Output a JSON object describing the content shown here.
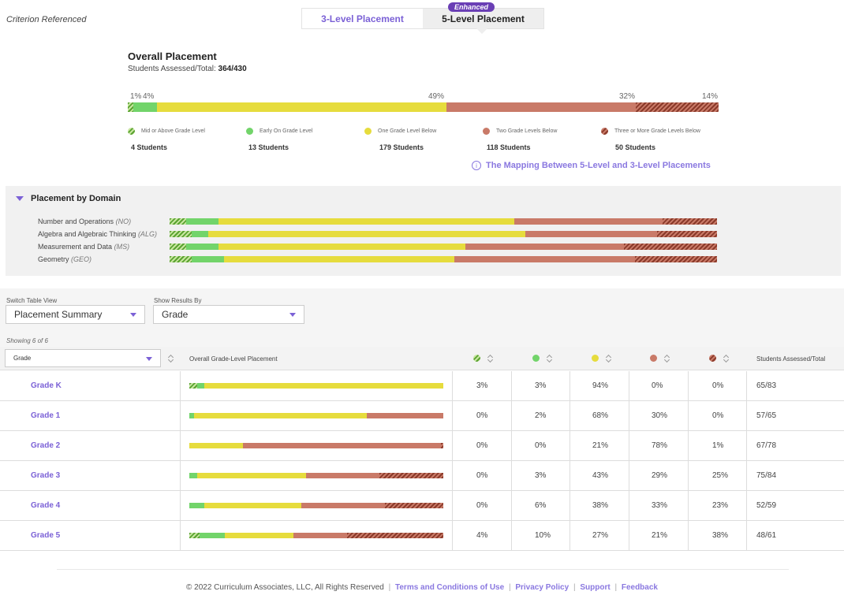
{
  "header": {
    "context_label": "Criterion Referenced",
    "tabs": [
      {
        "label": "3-Level Placement",
        "selected": false
      },
      {
        "label": "5-Level Placement",
        "selected": true
      }
    ],
    "badge": "Enhanced"
  },
  "overall": {
    "title": "Overall Placement",
    "assessed_label": "Students Assessed/Total:",
    "assessed_value": "364/430",
    "percent_labels": [
      "1%",
      "4%",
      "49%",
      "32%",
      "14%"
    ],
    "bar_segments": [
      1,
      4,
      49,
      32,
      14
    ]
  },
  "legend": [
    {
      "label": "Mid or Above Grade Level",
      "count": "4 Students",
      "color": "#5aa331"
    },
    {
      "label": "Early On Grade Level",
      "count": "13 Students",
      "color": "#72d46a"
    },
    {
      "label": "One Grade Level Below",
      "count": "179 Students",
      "color": "#e6dc3d"
    },
    {
      "label": "Two Grade Levels Below",
      "count": "118 Students",
      "color": "#c97a68"
    },
    {
      "label": "Three or More Grade Levels Below",
      "count": "50 Students",
      "color": "#8a3a2a"
    }
  ],
  "mapping_link": "The Mapping Between 5-Level and 3-Level Placements",
  "domain_panel": {
    "title": "Placement by Domain",
    "domains": [
      {
        "name": "Number and Operations",
        "abbr": "(NO)",
        "segments": [
          3,
          6,
          54,
          27,
          10
        ]
      },
      {
        "name": "Algebra and Algebraic Thinking",
        "abbr": "(ALG)",
        "segments": [
          4,
          3,
          58,
          24,
          11
        ]
      },
      {
        "name": "Measurement and Data",
        "abbr": "(MS)",
        "segments": [
          3,
          6,
          45,
          29,
          17
        ]
      },
      {
        "name": "Geometry",
        "abbr": "(GEO)",
        "segments": [
          4,
          6,
          42,
          33,
          15
        ]
      }
    ]
  },
  "controls": {
    "switch_label": "Switch Table View",
    "switch_value": "Placement Summary",
    "show_label": "Show Results By",
    "show_value": "Grade",
    "showing": "Showing 6 of 6"
  },
  "table": {
    "group_select": "Grade",
    "col_overall": "Overall Grade-Level Placement",
    "col_assessed": "Students Assessed/Total",
    "rows": [
      {
        "name": "Grade K",
        "values": [
          "3%",
          "3%",
          "94%",
          "0%",
          "0%"
        ],
        "assessed": "65/83",
        "segments": [
          3,
          3,
          94,
          0,
          0
        ]
      },
      {
        "name": "Grade 1",
        "values": [
          "0%",
          "2%",
          "68%",
          "30%",
          "0%"
        ],
        "assessed": "57/65",
        "segments": [
          0,
          2,
          68,
          30,
          0
        ]
      },
      {
        "name": "Grade 2",
        "values": [
          "0%",
          "0%",
          "21%",
          "78%",
          "1%"
        ],
        "assessed": "67/78",
        "segments": [
          0,
          0,
          21,
          78,
          1
        ]
      },
      {
        "name": "Grade 3",
        "values": [
          "0%",
          "3%",
          "43%",
          "29%",
          "25%"
        ],
        "assessed": "75/84",
        "segments": [
          0,
          3,
          43,
          29,
          25
        ]
      },
      {
        "name": "Grade 4",
        "values": [
          "0%",
          "6%",
          "38%",
          "33%",
          "23%"
        ],
        "assessed": "52/59",
        "segments": [
          0,
          6,
          38,
          33,
          23
        ]
      },
      {
        "name": "Grade 5",
        "values": [
          "4%",
          "10%",
          "27%",
          "21%",
          "38%"
        ],
        "assessed": "48/61",
        "segments": [
          4,
          10,
          27,
          21,
          38
        ]
      }
    ]
  },
  "footer": {
    "copyright": "© 2022 Curriculum Associates, LLC, All Rights Reserved",
    "links": [
      "Terms and Conditions of Use",
      "Privacy Policy",
      "Support",
      "Feedback"
    ]
  }
}
